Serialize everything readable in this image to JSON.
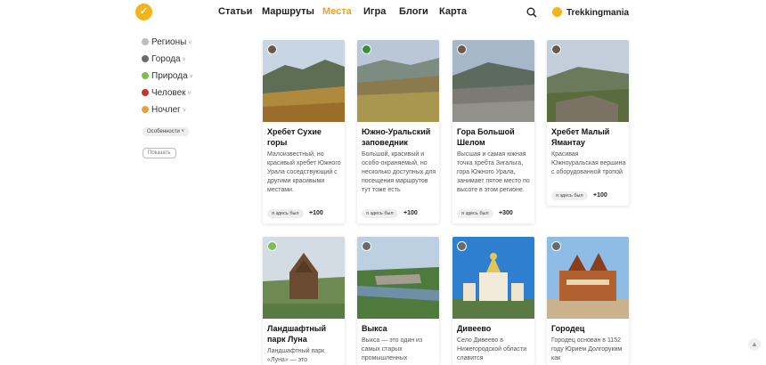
{
  "header": {
    "logo_glyph": "✓",
    "nav": [
      "Статьи",
      "Маршруты",
      "Места",
      "Игра",
      "Блоги",
      "Карта"
    ],
    "active_nav": "Места",
    "brand": "Trekkingmania"
  },
  "sidebar": {
    "items": [
      {
        "label": "Регионы",
        "color": "#bdbdbd"
      },
      {
        "label": "Города",
        "color": "#6a6a6a"
      },
      {
        "label": "Природа",
        "color": "#7cc04b"
      },
      {
        "label": "Человек",
        "color": "#c0392b"
      },
      {
        "label": "Ночлег",
        "color": "#e8a33d"
      }
    ],
    "features_label": "Особенности",
    "show_label": "Показать"
  },
  "cards": [
    {
      "title": "Хребет Сухие горы",
      "desc": "Малоизвестный, но красивый хребет Южного Урала соседствующий с другими красивыми местами.",
      "been": "я здесь был",
      "points": "+100",
      "badge": "#6a5a4a"
    },
    {
      "title": "Южно-Уральский заповедник",
      "desc": "Большой, красивый и особо-охраняемый, но несколько доступных для посещения маршрутов тут тоже есть",
      "been": "я здесь был",
      "points": "+100",
      "badge": "#3a8f3a"
    },
    {
      "title": "Гора Большой Шелом",
      "desc": "Высшая и самая южная точка хребта Зигальга, гора Южного Урала, занимает пятое место по высоте в этом регионе.",
      "been": "я здесь был",
      "points": "+300",
      "badge": "#6a5a4a"
    },
    {
      "title": "Хребет Малый Ямантау",
      "desc": "Красивая Южноуральская вершина с оборудованной тропой",
      "been": "я здесь был",
      "points": "+100",
      "badge": "#6a5a4a"
    },
    {
      "title": "Ландшафтный парк Луна",
      "desc": "Ландшафтный парк «Луна» — это",
      "badge": "#7cc04b"
    },
    {
      "title": "Выкса",
      "desc": "Выкса — это один из самых старых промышленных",
      "badge": "#6a6a6a"
    },
    {
      "title": "Дивеево",
      "desc": "Село Дивеево в Нижегородской области славится",
      "badge": "#6a6a6a"
    },
    {
      "title": "Городец",
      "desc": "Городец основан в 1152 году Юрием Долгоруким как",
      "badge": "#6a6a6a"
    }
  ]
}
